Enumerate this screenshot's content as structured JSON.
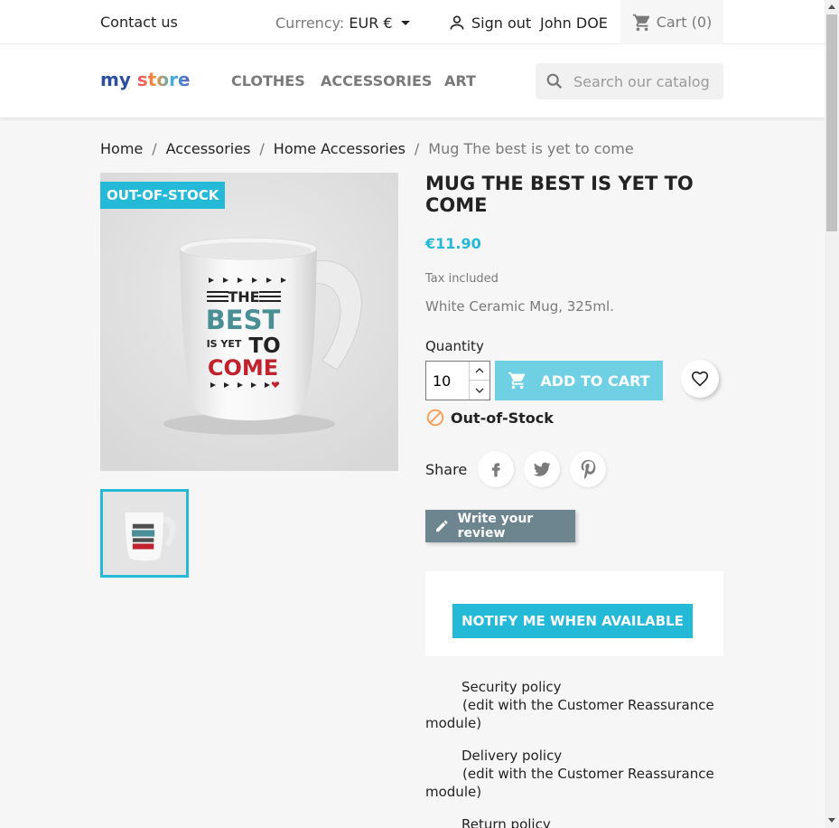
{
  "topbar": {
    "contact": "Contact us",
    "currency_label": "Currency:",
    "currency_value": "EUR €",
    "sign_out": "Sign out",
    "user": "John DOE",
    "cart": "Cart (0)"
  },
  "header": {
    "logo_my": "my",
    "logo_store": "store",
    "nav": [
      "CLOTHES",
      "ACCESSORIES",
      "ART"
    ],
    "search_placeholder": "Search our catalog"
  },
  "breadcrumb": [
    "Home",
    "Accessories",
    "Home Accessories",
    "Mug The best is yet to come"
  ],
  "product": {
    "flag": "OUT-OF-STOCK",
    "title": "MUG THE BEST IS YET TO COME",
    "price": "€11.90",
    "tax": "Tax included",
    "description": "White Ceramic Mug, 325ml.",
    "quantity_label": "Quantity",
    "quantity": "10",
    "add_to_cart": "ADD TO CART",
    "stock": "Out-of-Stock",
    "share_label": "Share",
    "review": "Write your review",
    "notify": "NOTIFY ME WHEN AVAILABLE",
    "mug_text": {
      "line1": "THE",
      "line2": "BEST",
      "line3a": "IS YET",
      "line3b": "TO",
      "line4": "COME"
    }
  },
  "reassurance": [
    {
      "title": "Security policy",
      "note": "(edit with the Customer Reassurance module)"
    },
    {
      "title": "Delivery policy",
      "note": "(edit with the Customer Reassurance module)"
    },
    {
      "title": "Return policy",
      "note": ""
    }
  ],
  "colors": {
    "accent": "#24b9d7",
    "add_to_cart_disabled": "#6fcfe3",
    "review_button": "#6c858f",
    "mug_teal": "#4b8f96",
    "mug_red": "#c1222d",
    "out_of_stock_icon": "#ff9a52"
  }
}
